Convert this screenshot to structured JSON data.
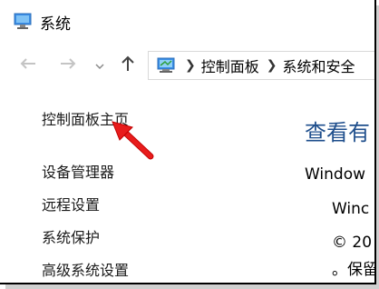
{
  "window": {
    "title": "系统"
  },
  "nav": {
    "address_crumbs": [
      "控制面板",
      "系统和安全"
    ]
  },
  "sidebar": {
    "items": [
      {
        "label": "控制面板主页"
      },
      {
        "label": "设备管理器"
      },
      {
        "label": "远程设置"
      },
      {
        "label": "系统保护"
      },
      {
        "label": "高级系统设置"
      }
    ]
  },
  "main": {
    "heading": "查看有",
    "edition_label": "Window",
    "edition_value": "Winc",
    "copyright": "© 20",
    "rights": "。保留"
  },
  "colors": {
    "heading": "#1e4e8c",
    "annotation_arrow": "#e81c1c"
  }
}
